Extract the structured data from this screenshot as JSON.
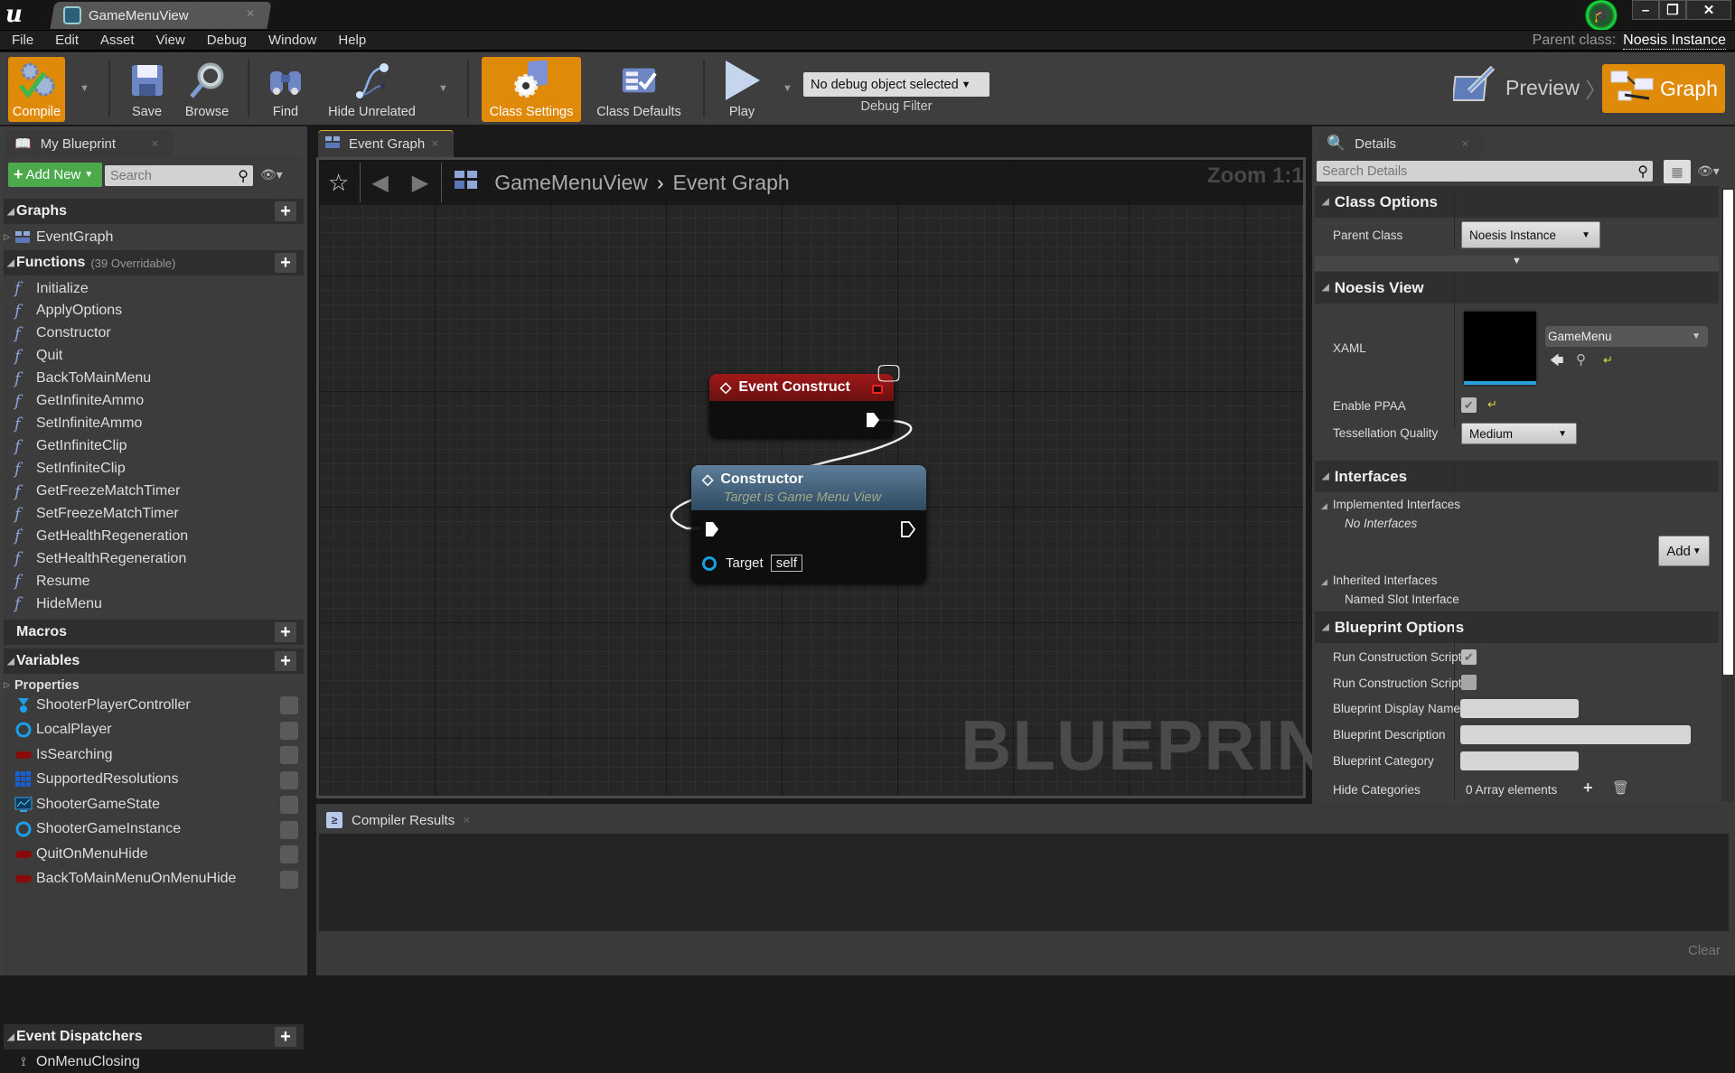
{
  "window": {
    "tab_title": "GameMenuView",
    "controls": [
      "minimize",
      "restore",
      "close"
    ]
  },
  "menu": [
    "File",
    "Edit",
    "Asset",
    "View",
    "Debug",
    "Window",
    "Help"
  ],
  "parent_class": {
    "label": "Parent class:",
    "value": "Noesis Instance"
  },
  "toolbar": {
    "compile": "Compile",
    "save": "Save",
    "browse": "Browse",
    "find": "Find",
    "hide_unrelated": "Hide Unrelated",
    "class_settings": "Class Settings",
    "class_defaults": "Class Defaults",
    "play": "Play",
    "debug_select": "No debug object selected",
    "debug_filter": "Debug Filter",
    "preview": "Preview",
    "graph": "Graph",
    "accent": "#e08a0a"
  },
  "my_blueprint": {
    "tab": "My Blueprint",
    "add_new": "Add New",
    "search_placeholder": "Search",
    "graphs": {
      "title": "Graphs",
      "items": [
        "EventGraph"
      ]
    },
    "functions": {
      "title": "Functions",
      "subtitle": "(39 Overridable)",
      "items": [
        "Initialize",
        "ApplyOptions",
        "Constructor",
        "Quit",
        "BackToMainMenu",
        "GetInfiniteAmmo",
        "SetInfiniteAmmo",
        "GetInfiniteClip",
        "SetInfiniteClip",
        "GetFreezeMatchTimer",
        "SetFreezeMatchTimer",
        "GetHealthRegeneration",
        "SetHealthRegeneration",
        "Resume",
        "HideMenu"
      ]
    },
    "macros": {
      "title": "Macros"
    },
    "variables": {
      "title": "Variables",
      "group": "Properties",
      "items": [
        {
          "name": "ShooterPlayerController",
          "type": "object-class"
        },
        {
          "name": "LocalPlayer",
          "type": "object"
        },
        {
          "name": "IsSearching",
          "type": "bool"
        },
        {
          "name": "SupportedResolutions",
          "type": "array"
        },
        {
          "name": "ShooterGameState",
          "type": "game-state"
        },
        {
          "name": "ShooterGameInstance",
          "type": "object"
        },
        {
          "name": "QuitOnMenuHide",
          "type": "bool"
        },
        {
          "name": "BackToMainMenuOnMenuHide",
          "type": "bool"
        }
      ]
    },
    "dispatchers": {
      "title": "Event Dispatchers",
      "items": [
        "OnMenuClosing"
      ]
    }
  },
  "graph": {
    "tab": "Event Graph",
    "breadcrumb": [
      "GameMenuView",
      "Event Graph"
    ],
    "zoom": "Zoom 1:1",
    "watermark": "BLUEPRINT",
    "nodes": {
      "event": {
        "title": "Event Construct"
      },
      "constructor": {
        "title": "Constructor",
        "subtitle": "Target is Game Menu View",
        "pin_label": "Target",
        "pin_value": "self"
      }
    }
  },
  "details": {
    "tab": "Details",
    "search_placeholder": "Search Details",
    "class_options": {
      "title": "Class Options",
      "parent_class_label": "Parent Class",
      "parent_class_value": "Noesis Instance"
    },
    "noesis_view": {
      "title": "Noesis View",
      "xaml_label": "XAML",
      "xaml_value": "GameMenu",
      "enable_ppaa_label": "Enable PPAA",
      "enable_ppaa": true,
      "tessellation_label": "Tessellation Quality",
      "tessellation_value": "Medium"
    },
    "interfaces": {
      "title": "Interfaces",
      "implemented_label": "Implemented Interfaces",
      "implemented_empty": "No Interfaces",
      "add_label": "Add",
      "inherited_label": "Inherited Interfaces",
      "inherited_items": [
        "Named Slot Interface"
      ]
    },
    "blueprint_options": {
      "title": "Blueprint Options",
      "run_cs_1_label": "Run Construction Script",
      "run_cs_1": true,
      "run_cs_2_label": "Run Construction Script",
      "run_cs_2": false,
      "display_name_label": "Blueprint Display Name",
      "display_name": "",
      "description_label": "Blueprint Description",
      "description": "",
      "category_label": "Blueprint Category",
      "category": "",
      "hide_categories_label": "Hide Categories",
      "hide_categories_value": "0 Array elements"
    }
  },
  "compiler": {
    "tab": "Compiler Results",
    "clear": "Clear"
  }
}
